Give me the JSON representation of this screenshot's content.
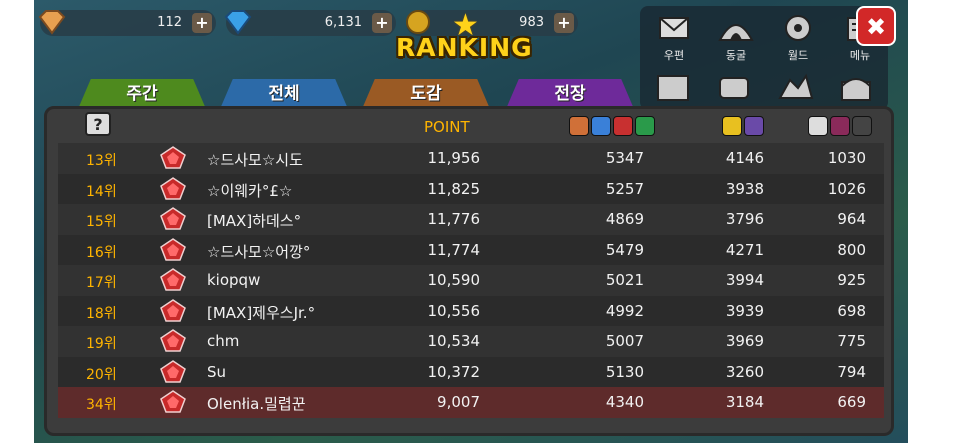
{
  "currency": [
    {
      "name": "crystal",
      "value": "112",
      "icon": "orange-gem-icon",
      "color": "#e8a050"
    },
    {
      "name": "diamond",
      "value": "6,131",
      "icon": "blue-diamond-icon",
      "color": "#3aa0e8"
    },
    {
      "name": "gold",
      "value": "983",
      "icon": "gold-coin-icon",
      "color": "#d6a420"
    }
  ],
  "title": "RANKING",
  "menu": [
    {
      "label": "우편",
      "icon": "mail-icon"
    },
    {
      "label": "동굴",
      "icon": "cave-icon"
    },
    {
      "label": "월드",
      "icon": "world-icon"
    },
    {
      "label": "메뉴",
      "icon": "menu-icon"
    }
  ],
  "menu_row2_icons": [
    "book-icon",
    "scroll-icon",
    "dragon-icon",
    "chest-icon"
  ],
  "tabs": [
    {
      "label": "주간",
      "color": "#4e8a1e"
    },
    {
      "label": "전체",
      "color": "#2c6aa8"
    },
    {
      "label": "도감",
      "color": "#9a5a24"
    },
    {
      "label": "전장",
      "color": "#6e2a9a"
    }
  ],
  "header": {
    "help": "?",
    "point": "POINT"
  },
  "rows": [
    {
      "rank": "13위",
      "name": "☆드사모☆시도",
      "point": "11,956",
      "c1": "5347",
      "c2": "4146",
      "c3": "1030"
    },
    {
      "rank": "14위",
      "name": "☆이웨카°£☆",
      "point": "11,825",
      "c1": "5257",
      "c2": "3938",
      "c3": "1026"
    },
    {
      "rank": "15위",
      "name": "[MAX]하데스°",
      "point": "11,776",
      "c1": "4869",
      "c2": "3796",
      "c3": "964"
    },
    {
      "rank": "16위",
      "name": "☆드사모☆어깡°",
      "point": "11,774",
      "c1": "5479",
      "c2": "4271",
      "c3": "800"
    },
    {
      "rank": "17위",
      "name": "kiopqw",
      "point": "10,590",
      "c1": "5021",
      "c2": "3994",
      "c3": "925"
    },
    {
      "rank": "18위",
      "name": "[MAX]제우스Jr.°",
      "point": "10,556",
      "c1": "4992",
      "c2": "3939",
      "c3": "698"
    },
    {
      "rank": "19위",
      "name": "chm",
      "point": "10,534",
      "c1": "5007",
      "c2": "3969",
      "c3": "775"
    },
    {
      "rank": "20위",
      "name": "Su",
      "point": "10,372",
      "c1": "5130",
      "c2": "3260",
      "c3": "794"
    },
    {
      "rank": "34위",
      "name": "Olenłia.밀렵꾼",
      "point": "9,007",
      "c1": "4340",
      "c2": "3184",
      "c3": "669"
    }
  ],
  "colors": {
    "rank": "#ffb400",
    "my_row": "#5e2b2b"
  }
}
